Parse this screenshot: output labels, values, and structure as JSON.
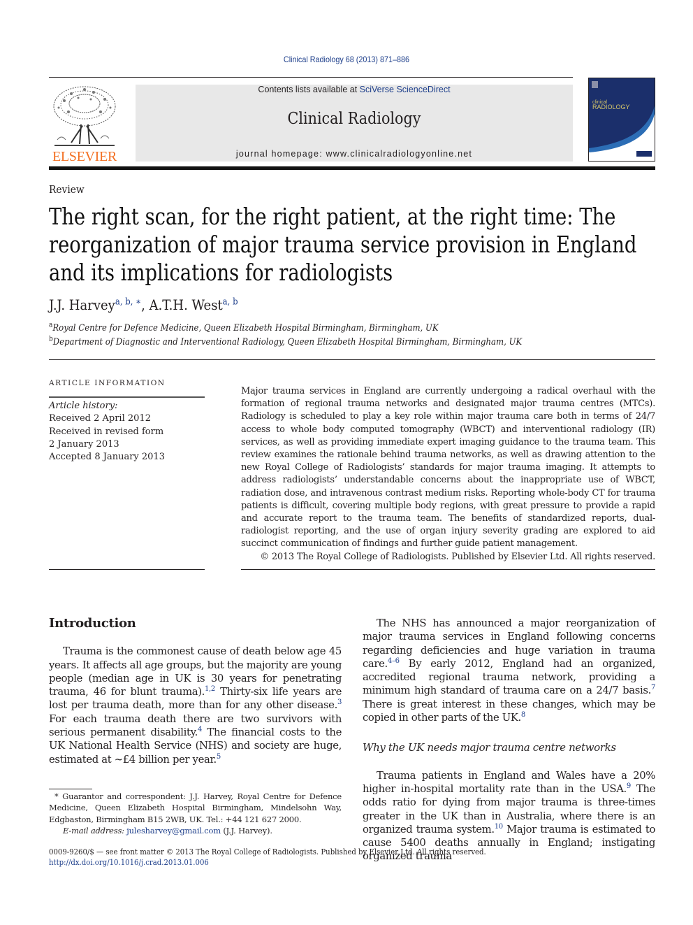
{
  "header": {
    "citation": "Clinical Radiology 68 (2013) 871–886",
    "publisher_logo_text": "ELSEVIER",
    "contents_prefix": "Contents lists available at ",
    "contents_link": "SciVerse ScienceDirect",
    "journal_title": "Clinical Radiology",
    "homepage_prefix": "journal homepage: ",
    "homepage_url": "www.clinicalradiologyonline.net",
    "cover_line1": "clinical",
    "cover_line2": "RADIOLOGY",
    "colors": {
      "link": "#1e3f8b",
      "elsevier_orange": "#f36f21",
      "masthead_gray": "#e8e8e8",
      "cover_blue": "#1b2f6b"
    }
  },
  "article": {
    "type": "Review",
    "title": "The right scan, for the right patient, at the right time: The reorganization of major trauma service provision in England and its implications for radiologists",
    "authors": [
      {
        "name": "J.J. Harvey",
        "marks": "a, b, ∗"
      },
      {
        "name": "A.T.H. West",
        "marks": "a, b"
      }
    ],
    "author_separator": ", ",
    "affiliations": [
      {
        "mark": "a",
        "text": "Royal Centre for Defence Medicine, Queen Elizabeth Hospital Birmingham, Birmingham, UK"
      },
      {
        "mark": "b",
        "text": "Department of Diagnostic and Interventional Radiology, Queen Elizabeth Hospital Birmingham, Birmingham, UK"
      }
    ]
  },
  "article_info": {
    "heading": "ARTICLE INFORMATION",
    "history_title": "Article history:",
    "history": [
      "Received 2 April 2012",
      "Received in revised form",
      "2 January 2013",
      "Accepted 8 January 2013"
    ]
  },
  "abstract": {
    "text": "Major trauma services in England are currently undergoing a radical overhaul with the formation of regional trauma networks and designated major trauma centres (MTCs). Radiology is scheduled to play a key role within major trauma care both in terms of 24/7 access to whole body computed tomography (WBCT) and interventional radiology (IR) services, as well as providing immediate expert imaging guidance to the trauma team. This review examines the rationale behind trauma networks, as well as drawing attention to the new Royal College of Radiologists’ standards for major trauma imaging. It attempts to address radiologists’ understandable concerns about the inappropriate use of WBCT, radiation dose, and intravenous contrast medium risks. Reporting whole-body CT for trauma patients is difficult, covering multiple body regions, with great pressure to provide a rapid and accurate report to the trauma team. The benefits of standardized reports, dual-radiologist reporting, and the use of organ injury severity grading are explored to aid succinct communication of findings and further guide patient management.",
    "copyright": "© 2013 The Royal College of Radiologists. Published by Elsevier Ltd. All rights reserved."
  },
  "body": {
    "intro_heading": "Introduction",
    "intro_para": [
      {
        "t": "Trauma is the commonest cause of death below age 45 years. It affects all age groups, but the majority are young people (median age in UK is 30 years for penetrating trauma, 46 for blunt trauma)."
      },
      {
        "ref": "1,2"
      },
      {
        "t": " Thirty-six life years are lost per trauma death, more than for any other disease."
      },
      {
        "ref": "3"
      },
      {
        "t": " For each trauma death there are two survivors with serious permanent disability."
      },
      {
        "ref": "4"
      },
      {
        "t": " The financial costs to the UK National Health Service (NHS) and society are huge, estimated at ∼£4 billion per year."
      },
      {
        "ref": "5"
      }
    ],
    "nhs_para": [
      {
        "t": "The NHS has announced a major reorganization of major trauma services in England following concerns regarding deficiencies and huge variation in trauma care."
      },
      {
        "ref": "4–6"
      },
      {
        "t": " By early 2012, England had an organized, accredited regional trauma network, providing a minimum high standard of trauma care on a 24/7 basis."
      },
      {
        "ref": "7"
      },
      {
        "t": " There is great interest in these changes, which may be copied in other parts of the UK."
      },
      {
        "ref": "8"
      }
    ],
    "subheading": "Why the UK needs major trauma centre networks",
    "why_para": [
      {
        "t": "Trauma patients in England and Wales have a 20% higher in-hospital mortality rate than in the USA."
      },
      {
        "ref": "9"
      },
      {
        "t": " The odds ratio for dying from major trauma is three-times greater in the UK than in Australia, where there is an organized trauma system."
      },
      {
        "ref": "10"
      },
      {
        "t": " Major trauma is estimated to cause 5400 deaths annually in England; instigating organized trauma"
      }
    ]
  },
  "footnote": {
    "mark": "*",
    "text": " Guarantor and correspondent: J.J. Harvey, Royal Centre for Defence Medicine, Queen Elizabeth Hospital Birmingham, Mindelsohn Way, Edgbaston, Birmingham B15 2WB, UK. Tel.: +44 121 627 2000.",
    "email_label": "E-mail address:",
    "email": "julesharvey@gmail.com",
    "email_suffix": " (J.J. Harvey)."
  },
  "footer": {
    "front_matter": "0009-9260/$ — see front matter © 2013 The Royal College of Radiologists. Published by Elsevier Ltd. All rights reserved.",
    "doi": "http://dx.doi.org/10.1016/j.crad.2013.01.006"
  }
}
